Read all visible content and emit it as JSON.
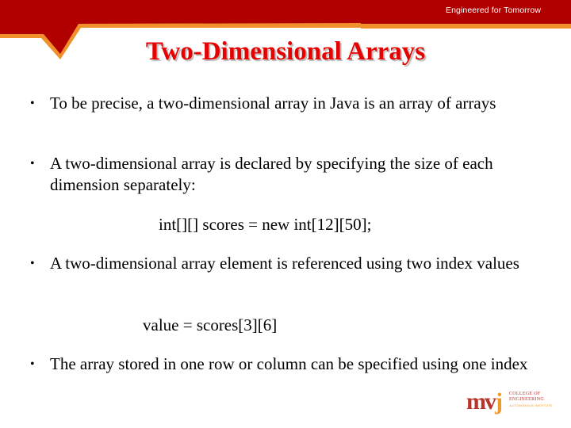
{
  "header": {
    "tagline": "Engineered for Tomorrow",
    "colors": {
      "band": "#b00000",
      "border": "#f0902a"
    }
  },
  "slide": {
    "title": "Two-Dimensional Arrays",
    "bullets": [
      {
        "marker": "•",
        "text": "To be precise, a two-dimensional array in Java is an array of arrays"
      },
      {
        "marker": "•",
        "text": "A two-dimensional array is declared by specifying the size of each dimension separately:"
      },
      {
        "marker": "•",
        "text": "A two-dimensional array element is referenced using two index values"
      },
      {
        "marker": "•",
        "text": "The array stored in one row or column can be specified using one index"
      }
    ],
    "code": [
      "int[][] scores = new int[12][50];",
      "value = scores[3][6]"
    ]
  },
  "logo": {
    "mark_mv": "mv",
    "mark_j": "j",
    "line1": "COLLEGE OF",
    "line2": "ENGINEERING",
    "line3": "AUTONOMOUS INSTITUTE"
  }
}
